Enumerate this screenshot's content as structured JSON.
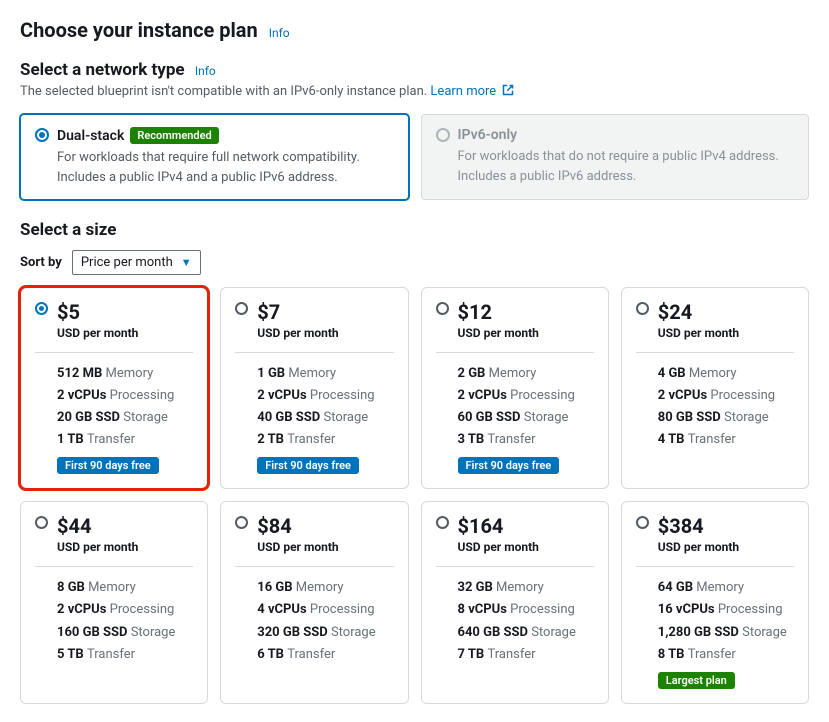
{
  "header": {
    "title": "Choose your instance plan",
    "info": "Info"
  },
  "network": {
    "title": "Select a network type",
    "info": "Info",
    "desc": "The selected blueprint isn't compatible with an IPv6-only instance plan.",
    "learn_more": "Learn more",
    "options": [
      {
        "label": "Dual-stack",
        "badge": "Recommended",
        "body": "For workloads that require full network compatibility. Includes a public IPv4 and a public IPv6 address.",
        "selected": true,
        "disabled": false
      },
      {
        "label": "IPv6-only",
        "badge": null,
        "body": "For workloads that do not require a public IPv4 address. Includes a public IPv6 address.",
        "selected": false,
        "disabled": true
      }
    ]
  },
  "size": {
    "title": "Select a size",
    "sort_label": "Sort by",
    "sort_value": "Price per month",
    "per_label": "USD per month",
    "spec_labels": {
      "memory": "Memory",
      "processing": "Processing",
      "storage": "Storage",
      "transfer": "Transfer"
    },
    "free_tag": "First 90 days free",
    "largest_tag": "Largest plan",
    "plans": [
      {
        "price": "$5",
        "memory": "512 MB",
        "cpu": "2 vCPUs",
        "storage": "20 GB SSD",
        "transfer": "1 TB",
        "free": true,
        "selected": true,
        "highlight": true,
        "largest": false
      },
      {
        "price": "$7",
        "memory": "1 GB",
        "cpu": "2 vCPUs",
        "storage": "40 GB SSD",
        "transfer": "2 TB",
        "free": true,
        "selected": false,
        "highlight": false,
        "largest": false
      },
      {
        "price": "$12",
        "memory": "2 GB",
        "cpu": "2 vCPUs",
        "storage": "60 GB SSD",
        "transfer": "3 TB",
        "free": true,
        "selected": false,
        "highlight": false,
        "largest": false
      },
      {
        "price": "$24",
        "memory": "4 GB",
        "cpu": "2 vCPUs",
        "storage": "80 GB SSD",
        "transfer": "4 TB",
        "free": false,
        "selected": false,
        "highlight": false,
        "largest": false
      },
      {
        "price": "$44",
        "memory": "8 GB",
        "cpu": "2 vCPUs",
        "storage": "160 GB SSD",
        "transfer": "5 TB",
        "free": false,
        "selected": false,
        "highlight": false,
        "largest": false
      },
      {
        "price": "$84",
        "memory": "16 GB",
        "cpu": "4 vCPUs",
        "storage": "320 GB SSD",
        "transfer": "6 TB",
        "free": false,
        "selected": false,
        "highlight": false,
        "largest": false
      },
      {
        "price": "$164",
        "memory": "32 GB",
        "cpu": "8 vCPUs",
        "storage": "640 GB SSD",
        "transfer": "7 TB",
        "free": false,
        "selected": false,
        "highlight": false,
        "largest": false
      },
      {
        "price": "$384",
        "memory": "64 GB",
        "cpu": "16 vCPUs",
        "storage": "1,280 GB SSD",
        "transfer": "8 TB",
        "free": false,
        "selected": false,
        "highlight": false,
        "largest": true
      }
    ]
  }
}
